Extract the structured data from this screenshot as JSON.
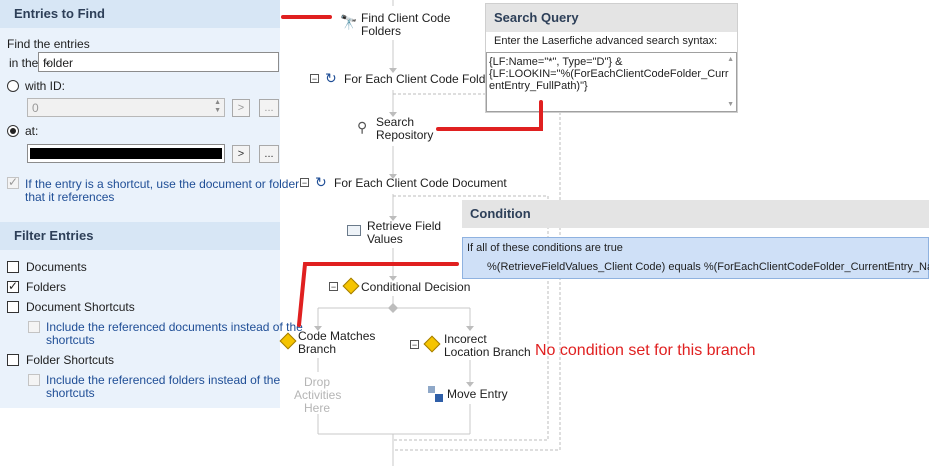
{
  "entries_to_find": {
    "title": "Entries to Find",
    "find_label": "Find the entries",
    "in_the_label": "in the",
    "folder_value": "folder",
    "with_id_label": "with ID:",
    "id_value": "0",
    "at_label": "at:",
    "browse_arrow": ">",
    "browse_dots": "...",
    "shortcut_text_line1": "If the entry is a shortcut, use the document or folder",
    "shortcut_text_line2": "that it references"
  },
  "filter_entries": {
    "title": "Filter Entries",
    "documents": "Documents",
    "folders": "Folders",
    "document_shortcuts": "Document Shortcuts",
    "include_docs_line1": "Include the referenced documents instead of the",
    "include_docs_line2": "shortcuts",
    "folder_shortcuts": "Folder Shortcuts",
    "include_folders_line1": "Include the referenced folders instead of the",
    "include_folders_line2": "shortcuts"
  },
  "workflow": {
    "find_client_line1": "Find Client Code",
    "find_client_line2": "Folders",
    "for_each_folder": "For Each Client Code Folder",
    "search_line1": "Search",
    "search_line2": "Repository",
    "for_each_document": "For Each Client Code Document",
    "retrieve_line1": "Retrieve Field",
    "retrieve_line2": "Values",
    "conditional": "Conditional Decision",
    "code_matches_line1": "Code Matches",
    "code_matches_line2": "Branch",
    "incorrect_line1": "Incorect",
    "incorrect_line2": "Location Branch",
    "drop_line1": "Drop",
    "drop_line2": "Activities",
    "drop_line3": "Here",
    "move_entry": "Move Entry"
  },
  "search_query": {
    "title": "Search Query",
    "instruction": "Enter the Laserfiche advanced search syntax:",
    "line1": "{LF:Name=\"*\", Type=\"D\"} &",
    "line2": "{LF:LOOKIN=\"%(ForEachClientCodeFolder_Curr",
    "line3": "entEntry_FullPath)\"}"
  },
  "condition": {
    "title": "Condition",
    "header": "If all of these conditions are true",
    "expression": "%(RetrieveFieldValues_Client Code) equals %(ForEachClientCodeFolder_CurrentEntry_Name)"
  },
  "annotation": {
    "no_condition": "No condition set for this branch"
  },
  "colors": {
    "annotation_red": "#e02020",
    "panel_bg": "#eaf2fb",
    "section_header": "#d7e6f5",
    "condition_highlight": "#cfe0f7"
  }
}
